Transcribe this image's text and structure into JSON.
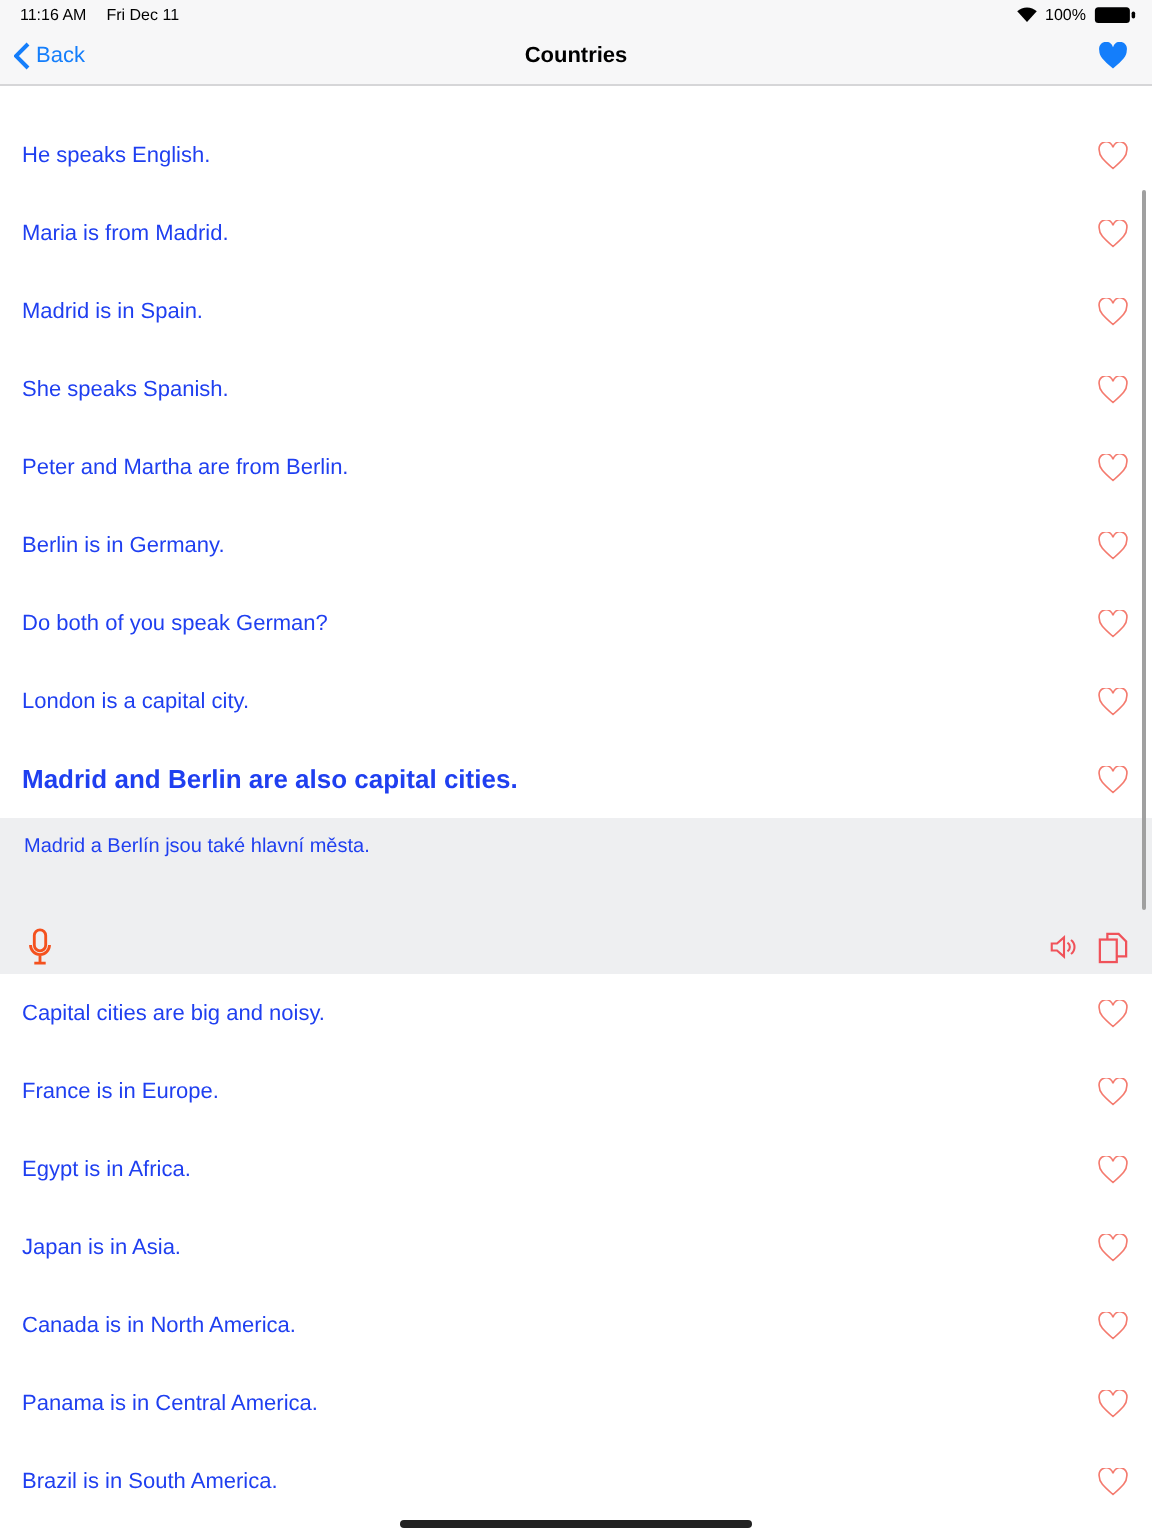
{
  "status_bar": {
    "time": "11:16 AM",
    "date": "Fri Dec 11",
    "battery": "100%"
  },
  "nav": {
    "back": "Back",
    "title": "Countries"
  },
  "phrases": [
    {
      "text": "He speaks English.",
      "favorite": false,
      "expanded": false
    },
    {
      "text": "Maria is from Madrid.",
      "favorite": false,
      "expanded": false
    },
    {
      "text": "Madrid is in Spain.",
      "favorite": false,
      "expanded": false
    },
    {
      "text": "She speaks Spanish.",
      "favorite": false,
      "expanded": false
    },
    {
      "text": "Peter and Martha are from Berlin.",
      "favorite": false,
      "expanded": false
    },
    {
      "text": "Berlin is in Germany.",
      "favorite": false,
      "expanded": false
    },
    {
      "text": "Do both of you speak German?",
      "favorite": false,
      "expanded": false
    },
    {
      "text": "London is a capital city.",
      "favorite": false,
      "expanded": false
    },
    {
      "text": "Madrid and Berlin are also capital cities.",
      "favorite": false,
      "expanded": true,
      "translation": "Madrid a Berlín jsou také hlavní města."
    },
    {
      "text": "Capital cities are big and noisy.",
      "favorite": false,
      "expanded": false
    },
    {
      "text": "France is in Europe.",
      "favorite": false,
      "expanded": false
    },
    {
      "text": "Egypt is in Africa.",
      "favorite": false,
      "expanded": false
    },
    {
      "text": "Japan is in Asia.",
      "favorite": false,
      "expanded": false
    },
    {
      "text": "Canada is in North America.",
      "favorite": false,
      "expanded": false
    },
    {
      "text": "Panama is in Central America.",
      "favorite": false,
      "expanded": false
    },
    {
      "text": "Brazil is in South America.",
      "favorite": false,
      "expanded": false
    }
  ]
}
